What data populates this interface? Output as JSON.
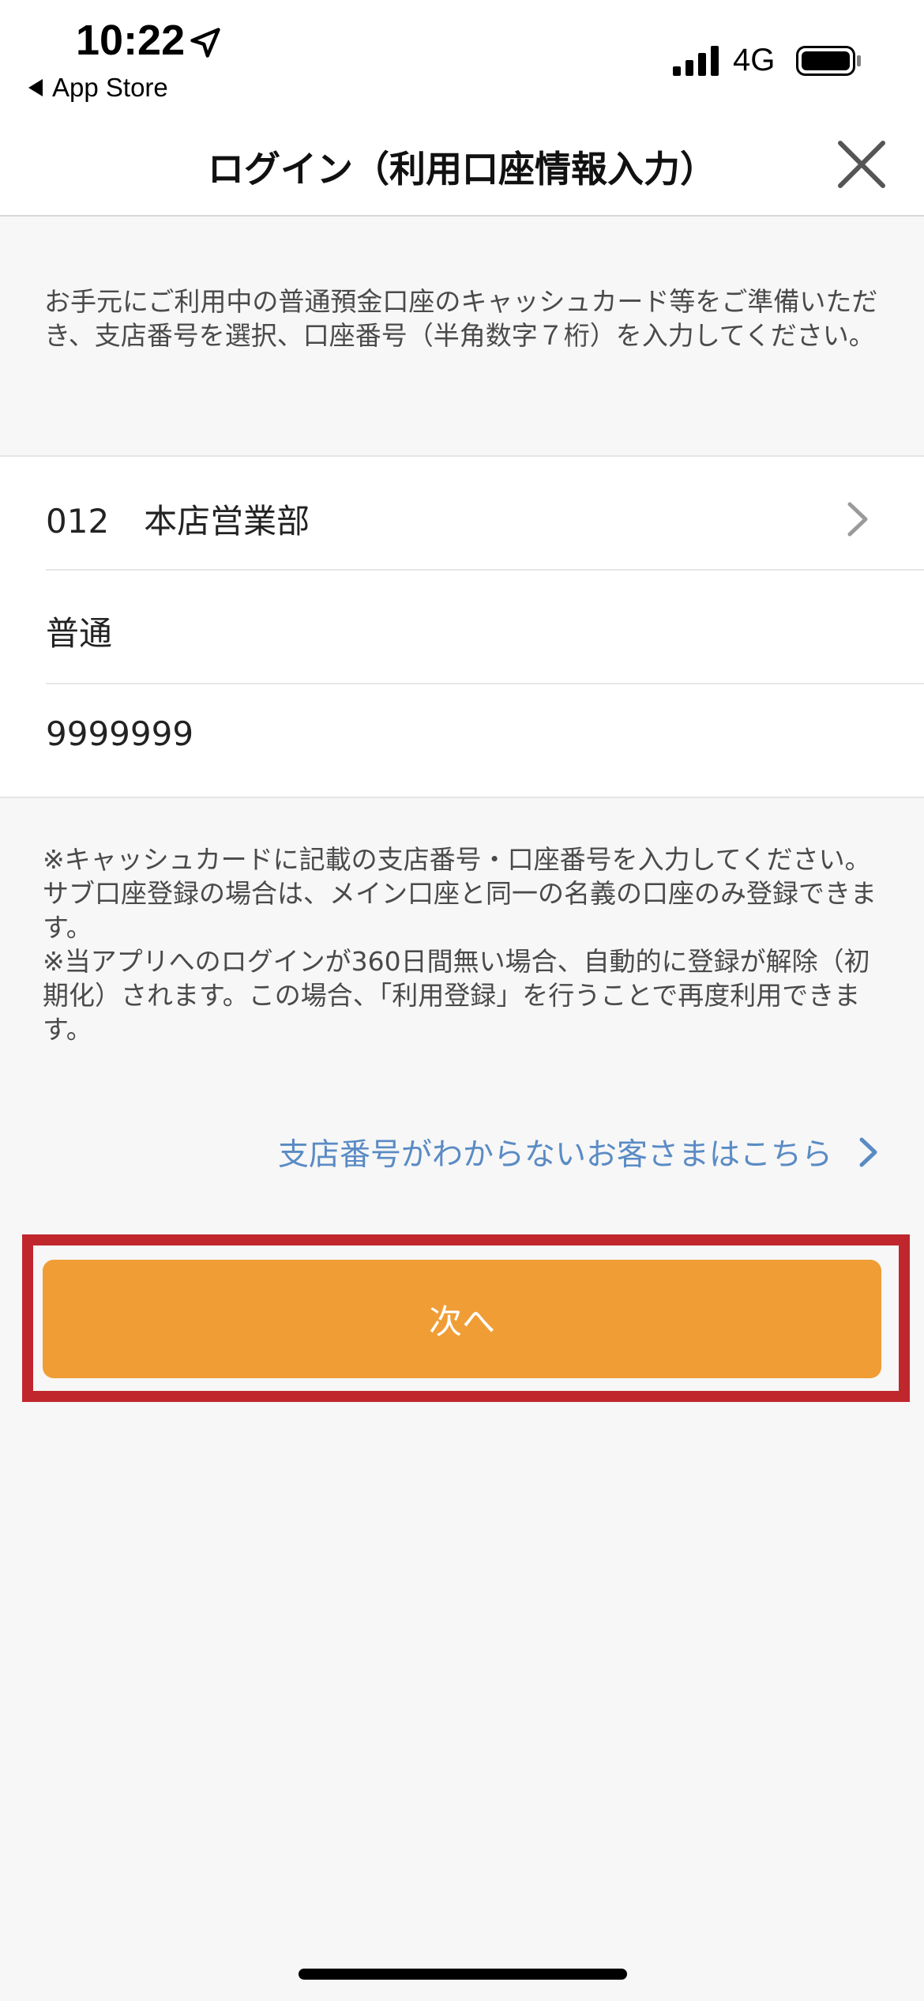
{
  "status_bar": {
    "time": "10:22",
    "back_label": "App Store",
    "network": "4G",
    "icons": [
      "location-arrow-icon",
      "signal-bars-icon",
      "battery-icon"
    ]
  },
  "header": {
    "title": "ログイン（利用口座情報入力）",
    "close_icon": "close-icon"
  },
  "intro": {
    "text": "お手元にご利用中の普通預金口座のキャッシュカード等をご準備いただき、支店番号を選択、口座番号（半角数字７桁）を入力してください。"
  },
  "form": {
    "branch_code": "012",
    "branch_name": "本店営業部",
    "account_type": "普通",
    "account_number": "9999999"
  },
  "notes": {
    "note1": "※キャッシュカードに記載の支店番号・口座番号を入力してください。サブ口座登録の場合は、メイン口座と同一の名義の口座のみ登録できます。",
    "note2": "※当アプリへのログインが360日間無い場合、自動的に登録が解除（初期化）されます。この場合、「利用登録」を行うことで再度利用できます。"
  },
  "help_link": {
    "label": "支店番号がわからないお客さまはこちら"
  },
  "actions": {
    "next_label": "次へ"
  },
  "colors": {
    "accent_button": "#f09d36",
    "link": "#5a8bc4",
    "highlight_border": "#c0272d"
  }
}
